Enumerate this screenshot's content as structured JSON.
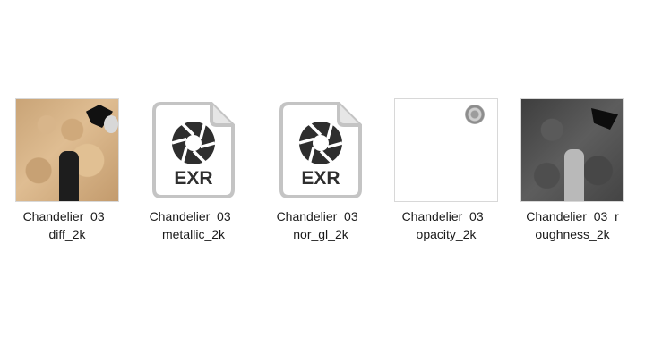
{
  "files": [
    {
      "name_line1": "Chandelier_03_",
      "name_line2": "diff_2k",
      "thumbnail": "diffuse-texture"
    },
    {
      "name_line1": "Chandelier_03_",
      "name_line2": "metallic_2k",
      "thumbnail": "exr-file-icon",
      "icon_text": "EXR"
    },
    {
      "name_line1": "Chandelier_03_",
      "name_line2": "nor_gl_2k",
      "thumbnail": "exr-file-icon",
      "icon_text": "EXR"
    },
    {
      "name_line1": "Chandelier_03_",
      "name_line2": "opacity_2k",
      "thumbnail": "opacity-texture"
    },
    {
      "name_line1": "Chandelier_03_r",
      "name_line2": "oughness_2k",
      "thumbnail": "roughness-texture"
    }
  ],
  "colors": {
    "background": "#ffffff",
    "text": "#1a1a1a",
    "exr_icon_border": "#c4c4c4",
    "exr_icon_glyph": "#2e2e2e"
  }
}
